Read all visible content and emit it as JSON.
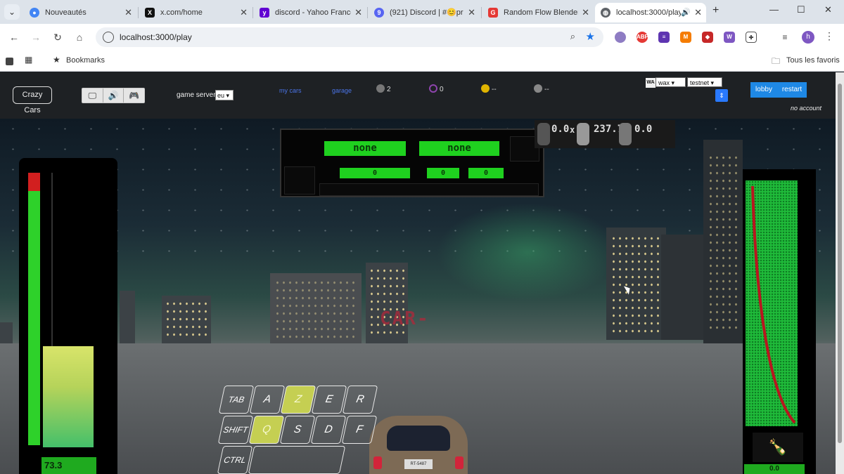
{
  "browser": {
    "tabs": [
      {
        "title": "Nouveautés",
        "icon": "chrome-icon",
        "color": "#4285f4"
      },
      {
        "title": "x.com/home",
        "icon": "x-logo-icon",
        "color": "#111111"
      },
      {
        "title": "discord - Yahoo France",
        "icon": "yahoo-icon",
        "color": "#6001d2"
      },
      {
        "title": "(921) Discord | #😊pr",
        "icon": "discord-icon",
        "color": "#5865f2"
      },
      {
        "title": "Random Flow Blender",
        "icon": "g-logo-icon",
        "color": "#e53935"
      },
      {
        "title": "localhost:3000/play",
        "icon": "globe-icon",
        "color": "#5f6368"
      }
    ],
    "url": "localhost:3000/play",
    "bookmarks_label": "Bookmarks",
    "all_bookmarks_label": "Tous les favoris",
    "profile_initial": "h"
  },
  "hud": {
    "brand": "Crazy Cars",
    "game_servers_label": "game servers",
    "server_value": "eu",
    "my_cars_label": "my cars",
    "garage_label": "garage",
    "cars_count": "2",
    "tokens_count": "0",
    "coins_value": "--",
    "globe_value": "--",
    "chain_value": "wax",
    "network_value": "testnet",
    "lobby_label": "lobby",
    "restart_label": "restart",
    "account_status": "no account",
    "accent_color": "#1e88e5"
  },
  "race": {
    "player1_name": "none",
    "player2_name": "none",
    "score_left": "0",
    "score_mid": "0",
    "score_right": "0",
    "timer": [
      "0.0",
      "237.7",
      "0.0"
    ],
    "time_prefix": "x"
  },
  "gauges": {
    "speed_readout": "73.3",
    "nitro_readout": "0.0"
  },
  "scene": {
    "sign_text": "CAR-",
    "plate_text": "RT-5487"
  },
  "keyboard": {
    "row1": [
      "TAB",
      "A",
      "Z",
      "E",
      "R"
    ],
    "row2": [
      "SHIFT",
      "Q",
      "S",
      "D",
      "F"
    ],
    "row3": [
      "CTRL"
    ],
    "active_keys": [
      "Z",
      "Q"
    ]
  }
}
